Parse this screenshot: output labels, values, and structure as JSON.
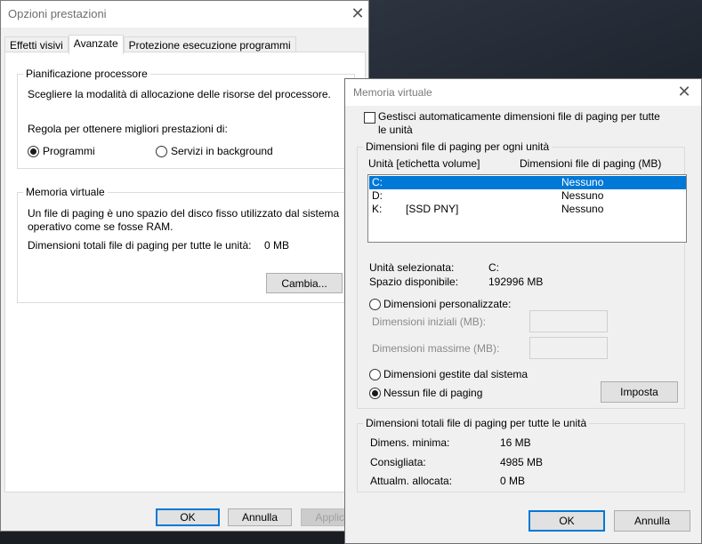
{
  "main_dialog": {
    "title": "Opzioni prestazioni",
    "tabs": [
      "Effetti visivi",
      "Avanzate",
      "Protezione esecuzione programmi"
    ],
    "processor": {
      "group_title": "Pianificazione processore",
      "description": "Scegliere la modalità di allocazione delle risorse del processore.",
      "adjust_label": "Regola per ottenere migliori prestazioni di:",
      "options": [
        "Programmi",
        "Servizi in background"
      ],
      "selected": "Programmi"
    },
    "virtual_memory": {
      "group_title": "Memoria virtuale",
      "description_line1": "Un file di paging è uno spazio del disco fisso utilizzato dal sistema",
      "description_line2": "operativo come se fosse RAM.",
      "total_label": "Dimensioni totali file di paging per tutte le unità:",
      "total_value": "0 MB",
      "change_button": "Cambia..."
    },
    "buttons": {
      "ok": "OK",
      "cancel": "Annulla",
      "apply": "Applica"
    }
  },
  "vm_dialog": {
    "title": "Memoria virtuale",
    "auto_manage_line1": "Gestisci automaticamente dimensioni file di paging per tutte",
    "auto_manage_line2": "le unità",
    "auto_manage_checked": false,
    "per_drive_group_title": "Dimensioni file di paging per ogni unità",
    "list_headers": {
      "drive": "Unità [etichetta volume]",
      "size": "Dimensioni file di paging (MB)"
    },
    "drives": [
      {
        "drive": "C:",
        "label": "",
        "size": "Nessuno",
        "selected": true
      },
      {
        "drive": "D:",
        "label": "",
        "size": "Nessuno",
        "selected": false
      },
      {
        "drive": "K:",
        "label": "[SSD PNY]",
        "size": "Nessuno",
        "selected": false
      }
    ],
    "selected_drive_label": "Unità selezionata:",
    "selected_drive_value": "C:",
    "free_space_label": "Spazio disponibile:",
    "free_space_value": "192996 MB",
    "custom_size_label": "Dimensioni personalizzate:",
    "initial_size_label": "Dimensioni iniziali (MB):",
    "max_size_label": "Dimensioni massime (MB):",
    "initial_size_value": "",
    "max_size_value": "",
    "system_managed_label": "Dimensioni gestite dal sistema",
    "no_paging_label": "Nessun file di paging",
    "selected_option": "Nessun file di paging",
    "set_button": "Imposta",
    "totals_group_title": "Dimensioni totali file di paging per tutte le unità",
    "min_label": "Dimens. minima:",
    "min_value": "16 MB",
    "recommended_label": "Consigliata:",
    "recommended_value": "4985 MB",
    "allocated_label": "Attualm. allocata:",
    "allocated_value": "0 MB",
    "buttons": {
      "ok": "OK",
      "cancel": "Annulla"
    }
  }
}
